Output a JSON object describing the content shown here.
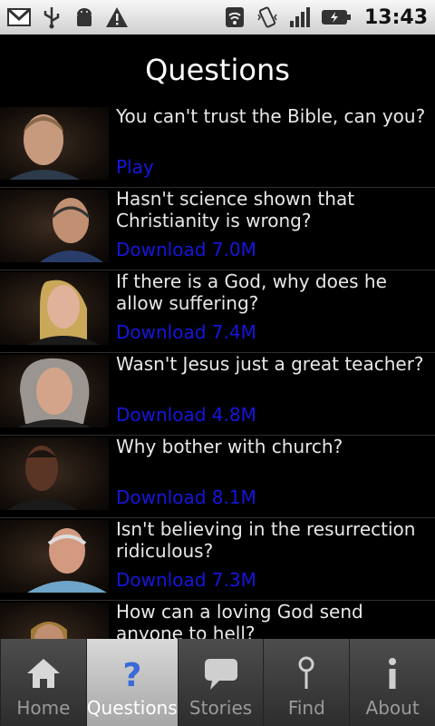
{
  "status": {
    "time": "13:43"
  },
  "header": {
    "title": "Questions"
  },
  "items": [
    {
      "question": "You can't trust the Bible, can you?",
      "action": "Play"
    },
    {
      "question": "Hasn't science shown that Christianity is wrong?",
      "action": "Download 7.0M"
    },
    {
      "question": "If there is a God, why does he allow suffering?",
      "action": "Download 7.4M"
    },
    {
      "question": "Wasn't Jesus just a great teacher?",
      "action": "Download 4.8M"
    },
    {
      "question": "Why bother with church?",
      "action": "Download 8.1M"
    },
    {
      "question": "Isn't believing in the resurrection ridiculous?",
      "action": "Download 7.3M"
    },
    {
      "question": "How can a loving God send anyone to hell?",
      "action": ""
    }
  ],
  "tabs": [
    {
      "label": "Home",
      "icon": "home-icon"
    },
    {
      "label": "Questions",
      "icon": "question-icon",
      "active": true
    },
    {
      "label": "Stories",
      "icon": "speech-bubble-icon"
    },
    {
      "label": "Find",
      "icon": "map-pin-icon"
    },
    {
      "label": "About",
      "icon": "info-icon"
    }
  ],
  "colors": {
    "link": "#1616dd",
    "background": "#000000",
    "active_tab": "#c0c0c0"
  }
}
